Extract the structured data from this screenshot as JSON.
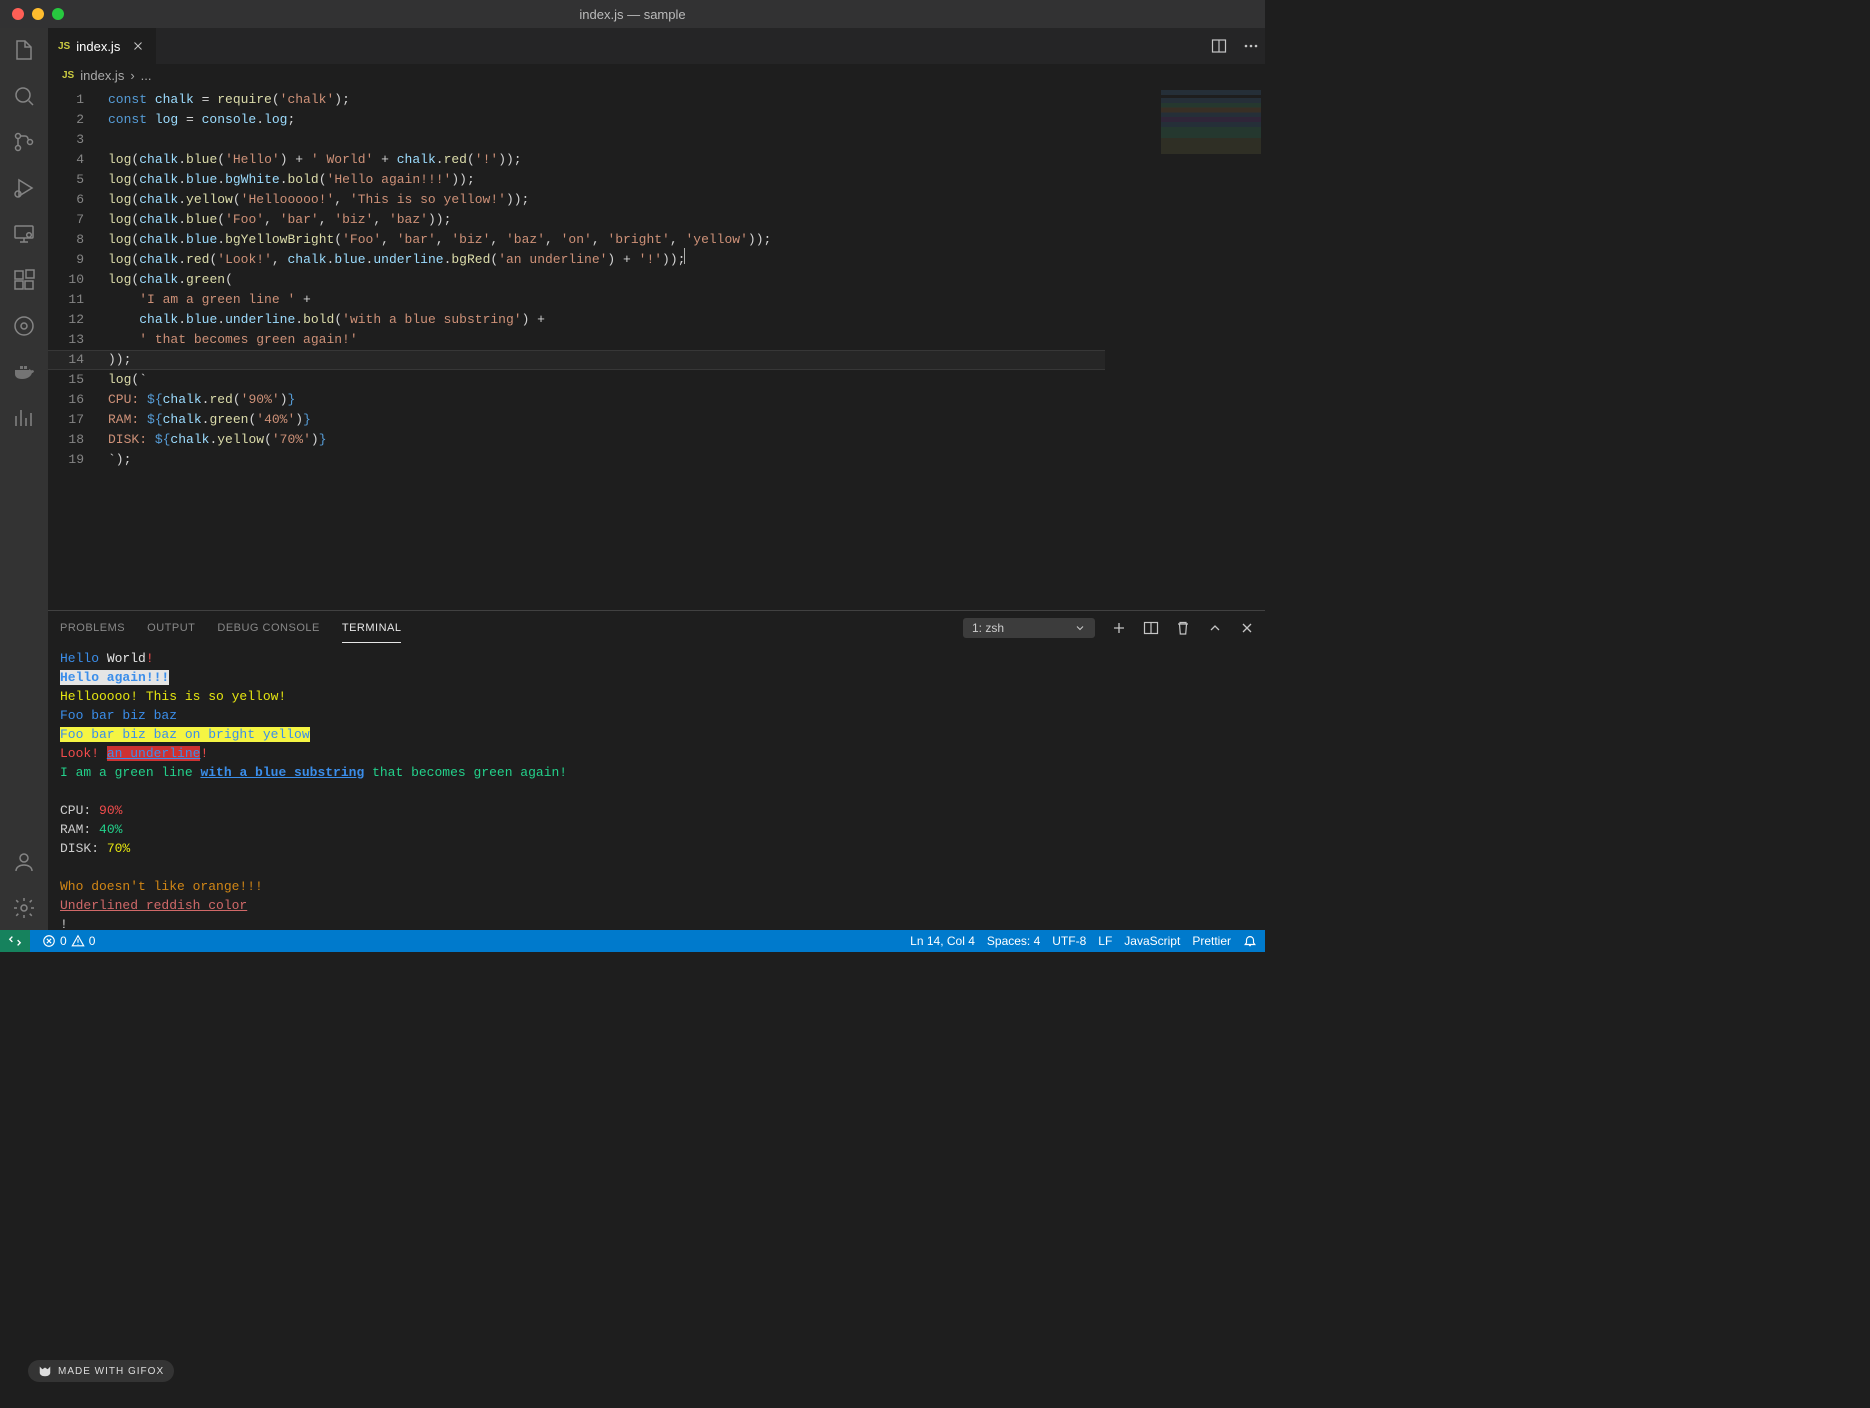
{
  "window": {
    "title": "index.js — sample"
  },
  "tab": {
    "badge": "JS",
    "filename": "index.js"
  },
  "breadcrumb": {
    "badge": "JS",
    "filename": "index.js",
    "separator": "›",
    "more": "..."
  },
  "activitybar": {
    "explorer": "explorer",
    "search": "search",
    "scm": "source-control",
    "debug": "run-and-debug",
    "remote": "remote-explorer",
    "ext": "extensions",
    "gitlens": "gitlens",
    "docker": "docker",
    "graph": "graph",
    "account": "accounts",
    "settings": "manage"
  },
  "code": {
    "lines": [
      [
        {
          "c": "kw",
          "t": "const "
        },
        {
          "c": "var",
          "t": "chalk"
        },
        {
          "t": " = "
        },
        {
          "c": "fn",
          "t": "require"
        },
        {
          "t": "("
        },
        {
          "c": "str",
          "t": "'chalk'"
        },
        {
          "t": ");"
        }
      ],
      [
        {
          "c": "kw",
          "t": "const "
        },
        {
          "c": "var",
          "t": "log"
        },
        {
          "t": " = "
        },
        {
          "c": "var",
          "t": "console"
        },
        {
          "t": "."
        },
        {
          "c": "var",
          "t": "log"
        },
        {
          "t": ";"
        }
      ],
      [],
      [
        {
          "c": "fn",
          "t": "log"
        },
        {
          "t": "("
        },
        {
          "c": "var",
          "t": "chalk"
        },
        {
          "t": "."
        },
        {
          "c": "fn",
          "t": "blue"
        },
        {
          "t": "("
        },
        {
          "c": "str",
          "t": "'Hello'"
        },
        {
          "t": ") + "
        },
        {
          "c": "str",
          "t": "' World'"
        },
        {
          "t": " + "
        },
        {
          "c": "var",
          "t": "chalk"
        },
        {
          "t": "."
        },
        {
          "c": "fn",
          "t": "red"
        },
        {
          "t": "("
        },
        {
          "c": "str",
          "t": "'!'"
        },
        {
          "t": "));"
        }
      ],
      [
        {
          "c": "fn",
          "t": "log"
        },
        {
          "t": "("
        },
        {
          "c": "var",
          "t": "chalk"
        },
        {
          "t": "."
        },
        {
          "c": "prop",
          "t": "blue"
        },
        {
          "t": "."
        },
        {
          "c": "prop",
          "t": "bgWhite"
        },
        {
          "t": "."
        },
        {
          "c": "fn",
          "t": "bold"
        },
        {
          "t": "("
        },
        {
          "c": "str",
          "t": "'Hello again!!!'"
        },
        {
          "t": "));"
        }
      ],
      [
        {
          "c": "fn",
          "t": "log"
        },
        {
          "t": "("
        },
        {
          "c": "var",
          "t": "chalk"
        },
        {
          "t": "."
        },
        {
          "c": "fn",
          "t": "yellow"
        },
        {
          "t": "("
        },
        {
          "c": "str",
          "t": "'Hellooooo!'"
        },
        {
          "t": ", "
        },
        {
          "c": "str",
          "t": "'This is so yellow!'"
        },
        {
          "t": "));"
        }
      ],
      [
        {
          "c": "fn",
          "t": "log"
        },
        {
          "t": "("
        },
        {
          "c": "var",
          "t": "chalk"
        },
        {
          "t": "."
        },
        {
          "c": "fn",
          "t": "blue"
        },
        {
          "t": "("
        },
        {
          "c": "str",
          "t": "'Foo'"
        },
        {
          "t": ", "
        },
        {
          "c": "str",
          "t": "'bar'"
        },
        {
          "t": ", "
        },
        {
          "c": "str",
          "t": "'biz'"
        },
        {
          "t": ", "
        },
        {
          "c": "str",
          "t": "'baz'"
        },
        {
          "t": "));"
        }
      ],
      [
        {
          "c": "fn",
          "t": "log"
        },
        {
          "t": "("
        },
        {
          "c": "var",
          "t": "chalk"
        },
        {
          "t": "."
        },
        {
          "c": "prop",
          "t": "blue"
        },
        {
          "t": "."
        },
        {
          "c": "fn",
          "t": "bgYellowBright"
        },
        {
          "t": "("
        },
        {
          "c": "str",
          "t": "'Foo'"
        },
        {
          "t": ", "
        },
        {
          "c": "str",
          "t": "'bar'"
        },
        {
          "t": ", "
        },
        {
          "c": "str",
          "t": "'biz'"
        },
        {
          "t": ", "
        },
        {
          "c": "str",
          "t": "'baz'"
        },
        {
          "t": ", "
        },
        {
          "c": "str",
          "t": "'on'"
        },
        {
          "t": ", "
        },
        {
          "c": "str",
          "t": "'bright'"
        },
        {
          "t": ", "
        },
        {
          "c": "str",
          "t": "'yellow'"
        },
        {
          "t": "));"
        }
      ],
      [
        {
          "c": "fn",
          "t": "log"
        },
        {
          "t": "("
        },
        {
          "c": "var",
          "t": "chalk"
        },
        {
          "t": "."
        },
        {
          "c": "fn",
          "t": "red"
        },
        {
          "t": "("
        },
        {
          "c": "str",
          "t": "'Look!'"
        },
        {
          "t": ", "
        },
        {
          "c": "var",
          "t": "chalk"
        },
        {
          "t": "."
        },
        {
          "c": "prop",
          "t": "blue"
        },
        {
          "t": "."
        },
        {
          "c": "prop",
          "t": "underline"
        },
        {
          "t": "."
        },
        {
          "c": "fn",
          "t": "bgRed"
        },
        {
          "t": "("
        },
        {
          "c": "str",
          "t": "'an underline'"
        },
        {
          "t": ") + "
        },
        {
          "c": "str",
          "t": "'!'"
        },
        {
          "t": "));"
        }
      ],
      [
        {
          "c": "fn",
          "t": "log"
        },
        {
          "t": "("
        },
        {
          "c": "var",
          "t": "chalk"
        },
        {
          "t": "."
        },
        {
          "c": "fn",
          "t": "green"
        },
        {
          "t": "("
        }
      ],
      [
        {
          "t": "    "
        },
        {
          "c": "str",
          "t": "'I am a green line '"
        },
        {
          "t": " +"
        }
      ],
      [
        {
          "t": "    "
        },
        {
          "c": "var",
          "t": "chalk"
        },
        {
          "t": "."
        },
        {
          "c": "prop",
          "t": "blue"
        },
        {
          "t": "."
        },
        {
          "c": "prop",
          "t": "underline"
        },
        {
          "t": "."
        },
        {
          "c": "fn",
          "t": "bold"
        },
        {
          "t": "("
        },
        {
          "c": "str",
          "t": "'with a blue substring'"
        },
        {
          "t": ") +"
        }
      ],
      [
        {
          "t": "    "
        },
        {
          "c": "str",
          "t": "' that becomes green again!'"
        }
      ],
      [
        {
          "t": "));"
        }
      ],
      [
        {
          "c": "fn",
          "t": "log"
        },
        {
          "t": "(`"
        }
      ],
      [
        {
          "c": "str",
          "t": "CPU: "
        },
        {
          "c": "kw",
          "t": "${"
        },
        {
          "c": "var",
          "t": "chalk"
        },
        {
          "t": "."
        },
        {
          "c": "fn",
          "t": "red"
        },
        {
          "t": "("
        },
        {
          "c": "str",
          "t": "'90%'"
        },
        {
          "t": ")"
        },
        {
          "c": "kw",
          "t": "}"
        }
      ],
      [
        {
          "c": "str",
          "t": "RAM: "
        },
        {
          "c": "kw",
          "t": "${"
        },
        {
          "c": "var",
          "t": "chalk"
        },
        {
          "t": "."
        },
        {
          "c": "fn",
          "t": "green"
        },
        {
          "t": "("
        },
        {
          "c": "str",
          "t": "'40%'"
        },
        {
          "t": ")"
        },
        {
          "c": "kw",
          "t": "}"
        }
      ],
      [
        {
          "c": "str",
          "t": "DISK: "
        },
        {
          "c": "kw",
          "t": "${"
        },
        {
          "c": "var",
          "t": "chalk"
        },
        {
          "t": "."
        },
        {
          "c": "fn",
          "t": "yellow"
        },
        {
          "t": "("
        },
        {
          "c": "str",
          "t": "'70%'"
        },
        {
          "t": ")"
        },
        {
          "c": "kw",
          "t": "}"
        }
      ],
      [
        {
          "t": "`);"
        }
      ]
    ]
  },
  "panel": {
    "tabs": [
      "PROBLEMS",
      "OUTPUT",
      "DEBUG CONSOLE",
      "TERMINAL"
    ],
    "active": 3,
    "termSelect": "1: zsh"
  },
  "terminal": {
    "out": [
      [
        {
          "c": "t-blue",
          "t": "Hello"
        },
        {
          "c": "t-white",
          "t": " World"
        },
        {
          "c": "t-red",
          "t": "!"
        }
      ],
      [
        {
          "c": "t-blue bg-white bold",
          "t": "Hello again!!!"
        }
      ],
      [
        {
          "c": "t-yellow",
          "t": "Hellooooo! This is so yellow!"
        }
      ],
      [
        {
          "c": "t-blue",
          "t": "Foo bar biz baz"
        }
      ],
      [
        {
          "c": "bg-yellowbright",
          "t": "Foo bar biz baz on bright yellow"
        }
      ],
      [
        {
          "c": "t-red",
          "t": "Look! "
        },
        {
          "c": "t-blue bg-red uline",
          "t": "an underline"
        },
        {
          "c": "t-red",
          "t": "!"
        }
      ],
      [
        {
          "c": "t-green",
          "t": "I am a green line "
        },
        {
          "c": "t-blue uline bold",
          "t": "with a blue substring"
        },
        {
          "c": "t-green",
          "t": " that becomes green again!"
        }
      ],
      [],
      [
        {
          "c": "t-grey",
          "t": "CPU: "
        },
        {
          "c": "t-red",
          "t": "90%"
        }
      ],
      [
        {
          "c": "t-grey",
          "t": "RAM: "
        },
        {
          "c": "t-green",
          "t": "40%"
        }
      ],
      [
        {
          "c": "t-grey",
          "t": "DISK: "
        },
        {
          "c": "t-yellow",
          "t": "70%"
        }
      ],
      [],
      [
        {
          "c": "t-orange",
          "t": "Who doesn't like orange!!!"
        }
      ],
      [
        {
          "c": "t-reddish",
          "t": "Underlined reddish color"
        }
      ],
      [
        {
          "c": "t-grey",
          "t": "!"
        }
      ]
    ]
  },
  "statusbar": {
    "errors": "0",
    "warnings": "0",
    "cursor": "Ln 14, Col 4",
    "spaces": "Spaces: 4",
    "encoding": "UTF-8",
    "eol": "LF",
    "language": "JavaScript",
    "prettier": "Prettier"
  },
  "watermark": "MADE WITH GIFOX"
}
